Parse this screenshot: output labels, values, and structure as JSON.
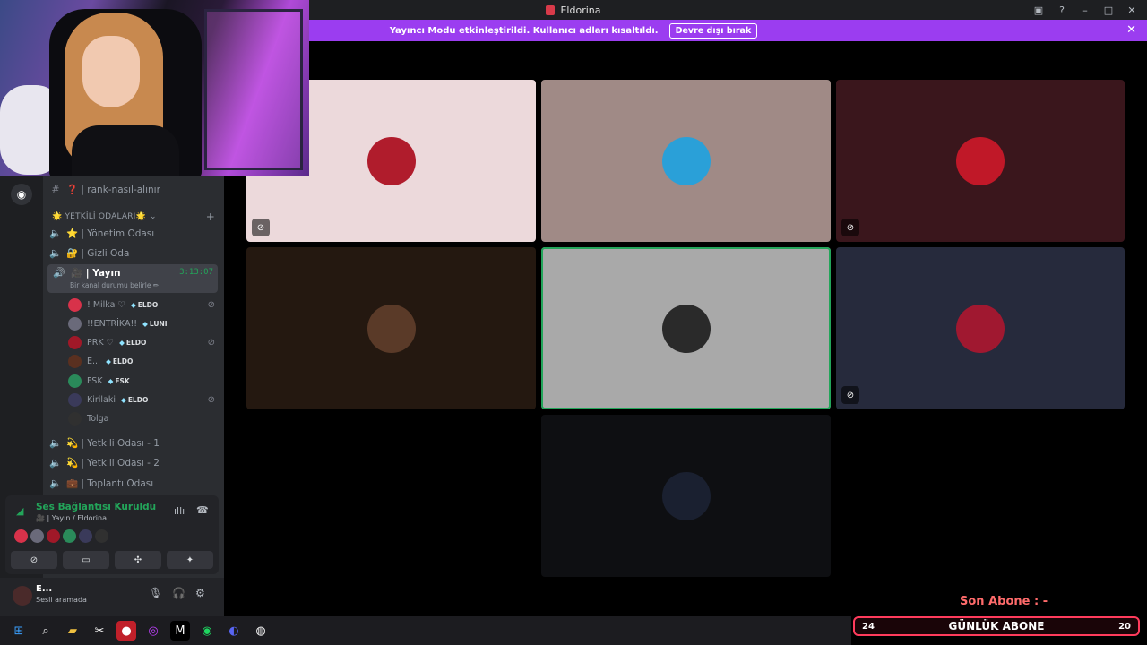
{
  "window": {
    "title": "Eldorina"
  },
  "banner": {
    "text": "Yayıncı Modu etkinleştirildi. Kullanıcı adları kısaltıldı.",
    "button": "Devre dışı bırak"
  },
  "sidebar": {
    "top_channel": "❓ | rank-nasıl-alınır",
    "category": "🌟 YETKİLİ ODALARI🌟",
    "channels_top": [
      "⭐ | Yönetim Odası",
      "🔐 | Gizli Oda"
    ],
    "active_channel": {
      "name": "🎥 | Yayın",
      "timer": "3:13:07",
      "status": "Bir kanal durumu belirle ✏"
    },
    "users": [
      {
        "name": "! Milka ♡",
        "tag": "ELDO",
        "muted": true,
        "color": "#d8324a"
      },
      {
        "name": "!!ENTRİKA!!",
        "tag": "LUNI",
        "muted": false,
        "color": "#6a6a7a"
      },
      {
        "name": "PRK ♡",
        "tag": "ELDO",
        "muted": true,
        "color": "#a01828"
      },
      {
        "name": "E...",
        "tag": "ELDO",
        "muted": false,
        "color": "#5a3020"
      },
      {
        "name": "FSK",
        "tag": "FSK",
        "muted": false,
        "color": "#2a8a5a"
      },
      {
        "name": "Kirilaki",
        "tag": "ELDO",
        "muted": true,
        "color": "#3a3a5a"
      },
      {
        "name": "Tolga",
        "tag": "",
        "muted": false,
        "color": "#303030"
      }
    ],
    "channels_bottom": [
      "💫 | Yetkili Odası - 1",
      "💫 | Yetkili Odası - 2",
      "💼 | Toplantı Odası"
    ]
  },
  "voice": {
    "title": "Ses Bağlantısı Kuruldu",
    "subtitle": "🎥 | Yayın / Eldorina"
  },
  "me": {
    "name": "E...",
    "status": "Sesli aramada"
  },
  "tiles": [
    {
      "bg": "#ecd9db",
      "avatar": "#b01c2c",
      "muted": true,
      "speaking": false
    },
    {
      "bg": "#a08a86",
      "avatar": "#2aa0d8",
      "muted": false,
      "speaking": false
    },
    {
      "bg": "#3a161c",
      "avatar": "#c01828",
      "muted": true,
      "speaking": false
    },
    {
      "bg": "#241810",
      "avatar": "#5a3a28",
      "muted": false,
      "speaking": false
    },
    {
      "bg": "#a9a9a9",
      "avatar": "#2a2a2a",
      "muted": false,
      "speaking": true
    },
    {
      "bg": "#262a3c",
      "avatar": "#a01830",
      "muted": true,
      "speaking": false
    },
    {
      "bg": "#0e0f12",
      "avatar": "#1a2030",
      "muted": false,
      "speaking": false
    }
  ],
  "overlay": {
    "son_abone": "Son Abone : -",
    "gunluk_label": "GÜNLÜK ABONE",
    "left": "24",
    "right": "20"
  }
}
